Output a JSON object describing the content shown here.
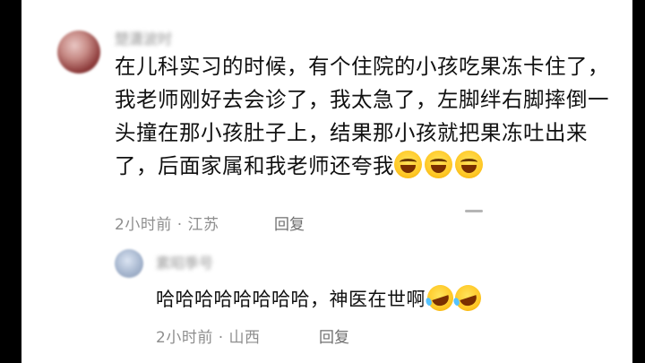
{
  "comment": {
    "author": "楚潇波时",
    "text": "在儿科实习的时候，有个住院的小孩吃果冻卡住了，我老师刚好去会诊了，我太急了，左脚绊右脚摔倒一头撞在那小孩肚子上，结果那小孩就把果冻吐出来了，后面家属和我老师还夸我",
    "emoji": [
      "sweat-smile-icon",
      "sweat-smile-icon",
      "sweat-smile-icon"
    ],
    "time": "2小时前",
    "location": "江苏",
    "reply_label": "回复"
  },
  "reply": {
    "author": "素昭季号",
    "text": "哈哈哈哈哈哈哈哈，神医在世啊",
    "emoji": [
      "laughing-tears-icon",
      "laughing-tears-icon"
    ],
    "time": "2小时前",
    "location": "山西",
    "reply_label": "回复"
  }
}
